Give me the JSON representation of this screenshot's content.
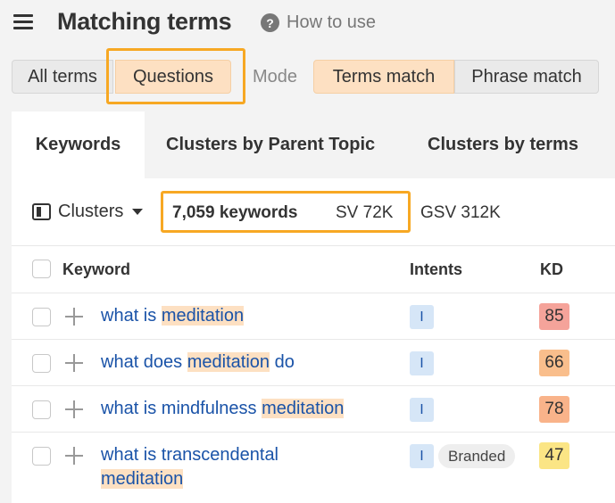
{
  "header": {
    "title": "Matching terms",
    "how_to_use": "How to use",
    "help_glyph": "?"
  },
  "filters": {
    "all_terms": "All terms",
    "questions": "Questions",
    "mode_label": "Mode",
    "terms_match": "Terms match",
    "phrase_match": "Phrase match",
    "active_filter": "Questions",
    "active_mode": "Terms match"
  },
  "tabs": [
    {
      "label": "Keywords",
      "active": true
    },
    {
      "label": "Clusters by Parent Topic",
      "active": false
    },
    {
      "label": "Clusters by terms",
      "active": false
    }
  ],
  "summary": {
    "clusters_label": "Clusters",
    "keywords_count": "7,059 keywords",
    "sv": "SV 72K",
    "gsv": "GSV 312K"
  },
  "table": {
    "headers": {
      "keyword": "Keyword",
      "intents": "Intents",
      "kd": "KD"
    },
    "rows": [
      {
        "kw_pre": "what is ",
        "kw_hl": "meditation",
        "kw_post": "",
        "intent": "I",
        "branded": "",
        "kd": "85",
        "kd_color": "#f5a39a"
      },
      {
        "kw_pre": "what does ",
        "kw_hl": "meditation",
        "kw_post": " do",
        "intent": "I",
        "branded": "",
        "kd": "66",
        "kd_color": "#f9be8c"
      },
      {
        "kw_pre": "what is mindfulness ",
        "kw_hl": "meditation",
        "kw_post": "",
        "intent": "I",
        "branded": "",
        "kd": "78",
        "kd_color": "#f9b38a"
      },
      {
        "kw_pre": "what is transcendental ",
        "kw_hl": "meditation",
        "kw_post": "",
        "intent": "I",
        "branded": "Branded",
        "kd": "47",
        "kd_color": "#fbe585"
      }
    ]
  },
  "colors": {
    "accent_highlight": "#f7a823",
    "active_button": "#fde0c2",
    "link": "#1a53a8"
  }
}
